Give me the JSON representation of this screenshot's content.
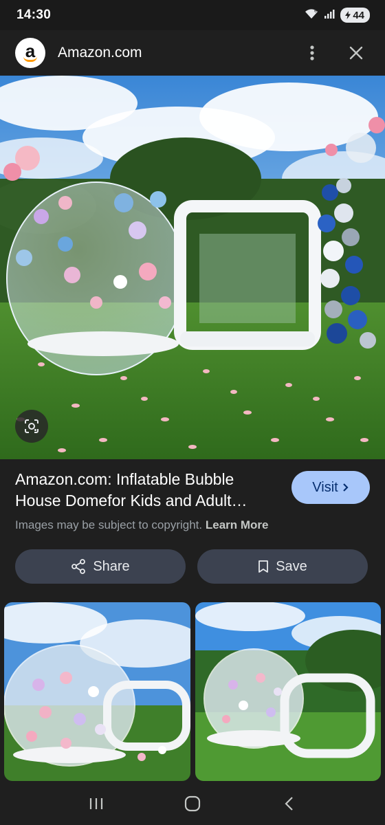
{
  "status": {
    "time": "14:30",
    "battery": "44"
  },
  "header": {
    "site_name": "Amazon.com",
    "logo_letter": "a"
  },
  "image_result": {
    "title": "Amazon.com: Inflatable Bubble House Domefor Kids and Adult…",
    "copyright_text": "Images may be subject to copyright.",
    "learn_more": "Learn More",
    "visit_label": "Visit"
  },
  "actions": {
    "share_label": "Share",
    "save_label": "Save"
  },
  "icons": {
    "wifi": "wifi-icon",
    "signal": "signal-icon",
    "more": "more-vert-icon",
    "close": "close-icon",
    "lens": "lens-icon",
    "chevron": "chevron-right-icon",
    "share": "share-icon",
    "save": "bookmark-icon",
    "nav_recents": "recents-icon",
    "nav_home": "home-icon",
    "nav_back": "back-icon"
  },
  "colors": {
    "background": "#1f1f1f",
    "visit_button": "#a8c7fa",
    "action_button": "#3c4250"
  }
}
